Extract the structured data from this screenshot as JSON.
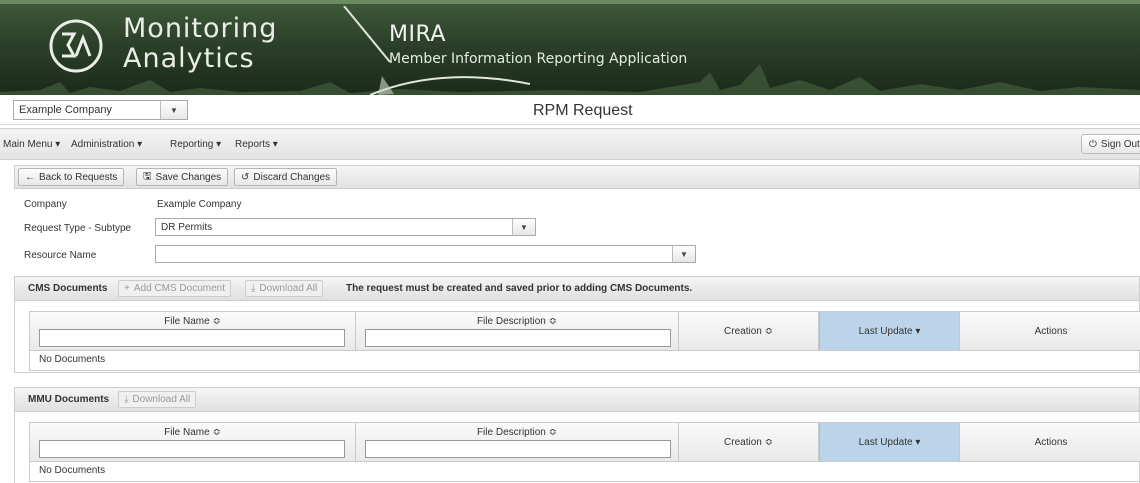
{
  "banner": {
    "brand_line1": "Monitoring",
    "brand_line2": "Analytics",
    "app_title": "MIRA",
    "app_subtitle": "Member Information Reporting Application",
    "logo_icon": "monitoring-analytics-logo",
    "colors": {
      "background": "#2c4129",
      "text": "#e9efe6"
    }
  },
  "header": {
    "company_selected": "Example Company",
    "page_title": "RPM Request"
  },
  "menu": {
    "items": [
      "Main Menu ▾",
      "Administration ▾",
      "Reporting ▾",
      "Reports ▾"
    ],
    "signout_label": "Sign Out"
  },
  "toolbar": {
    "back_label": "Back to Requests",
    "save_label": "Save Changes",
    "discard_label": "Discard Changes"
  },
  "form": {
    "company_label": "Company",
    "company_value": "Example Company",
    "request_type_label": "Request Type - Subtype",
    "request_type_value": "DR Permits",
    "resource_name_label": "Resource Name",
    "resource_name_value": ""
  },
  "cms_panel": {
    "title": "CMS Documents",
    "add_label": "Add CMS Document",
    "download_label": "Download All",
    "message": "The request must be created and saved prior to adding CMS Documents.",
    "columns": [
      "File Name ≎",
      "File Description ≎",
      "Creation ≎",
      "Last Update ▾",
      "Actions"
    ],
    "empty_text": "No Documents"
  },
  "mmu_panel": {
    "title": "MMU Documents",
    "download_label": "Download All",
    "columns": [
      "File Name ≎",
      "File Description ≎",
      "Creation ≎",
      "Last Update ▾",
      "Actions"
    ],
    "empty_text": "No Documents"
  }
}
